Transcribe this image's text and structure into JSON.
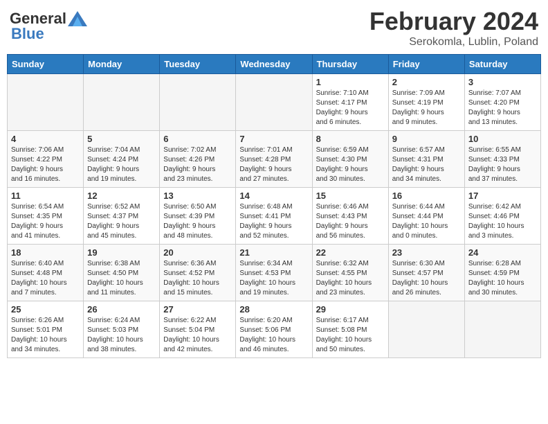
{
  "header": {
    "logo_general": "General",
    "logo_blue": "Blue",
    "title": "February 2024",
    "location": "Serokomla, Lublin, Poland"
  },
  "days_of_week": [
    "Sunday",
    "Monday",
    "Tuesday",
    "Wednesday",
    "Thursday",
    "Friday",
    "Saturday"
  ],
  "weeks": [
    [
      {
        "day": "",
        "info": ""
      },
      {
        "day": "",
        "info": ""
      },
      {
        "day": "",
        "info": ""
      },
      {
        "day": "",
        "info": ""
      },
      {
        "day": "1",
        "info": "Sunrise: 7:10 AM\nSunset: 4:17 PM\nDaylight: 9 hours\nand 6 minutes."
      },
      {
        "day": "2",
        "info": "Sunrise: 7:09 AM\nSunset: 4:19 PM\nDaylight: 9 hours\nand 9 minutes."
      },
      {
        "day": "3",
        "info": "Sunrise: 7:07 AM\nSunset: 4:20 PM\nDaylight: 9 hours\nand 13 minutes."
      }
    ],
    [
      {
        "day": "4",
        "info": "Sunrise: 7:06 AM\nSunset: 4:22 PM\nDaylight: 9 hours\nand 16 minutes."
      },
      {
        "day": "5",
        "info": "Sunrise: 7:04 AM\nSunset: 4:24 PM\nDaylight: 9 hours\nand 19 minutes."
      },
      {
        "day": "6",
        "info": "Sunrise: 7:02 AM\nSunset: 4:26 PM\nDaylight: 9 hours\nand 23 minutes."
      },
      {
        "day": "7",
        "info": "Sunrise: 7:01 AM\nSunset: 4:28 PM\nDaylight: 9 hours\nand 27 minutes."
      },
      {
        "day": "8",
        "info": "Sunrise: 6:59 AM\nSunset: 4:30 PM\nDaylight: 9 hours\nand 30 minutes."
      },
      {
        "day": "9",
        "info": "Sunrise: 6:57 AM\nSunset: 4:31 PM\nDaylight: 9 hours\nand 34 minutes."
      },
      {
        "day": "10",
        "info": "Sunrise: 6:55 AM\nSunset: 4:33 PM\nDaylight: 9 hours\nand 37 minutes."
      }
    ],
    [
      {
        "day": "11",
        "info": "Sunrise: 6:54 AM\nSunset: 4:35 PM\nDaylight: 9 hours\nand 41 minutes."
      },
      {
        "day": "12",
        "info": "Sunrise: 6:52 AM\nSunset: 4:37 PM\nDaylight: 9 hours\nand 45 minutes."
      },
      {
        "day": "13",
        "info": "Sunrise: 6:50 AM\nSunset: 4:39 PM\nDaylight: 9 hours\nand 48 minutes."
      },
      {
        "day": "14",
        "info": "Sunrise: 6:48 AM\nSunset: 4:41 PM\nDaylight: 9 hours\nand 52 minutes."
      },
      {
        "day": "15",
        "info": "Sunrise: 6:46 AM\nSunset: 4:43 PM\nDaylight: 9 hours\nand 56 minutes."
      },
      {
        "day": "16",
        "info": "Sunrise: 6:44 AM\nSunset: 4:44 PM\nDaylight: 10 hours\nand 0 minutes."
      },
      {
        "day": "17",
        "info": "Sunrise: 6:42 AM\nSunset: 4:46 PM\nDaylight: 10 hours\nand 3 minutes."
      }
    ],
    [
      {
        "day": "18",
        "info": "Sunrise: 6:40 AM\nSunset: 4:48 PM\nDaylight: 10 hours\nand 7 minutes."
      },
      {
        "day": "19",
        "info": "Sunrise: 6:38 AM\nSunset: 4:50 PM\nDaylight: 10 hours\nand 11 minutes."
      },
      {
        "day": "20",
        "info": "Sunrise: 6:36 AM\nSunset: 4:52 PM\nDaylight: 10 hours\nand 15 minutes."
      },
      {
        "day": "21",
        "info": "Sunrise: 6:34 AM\nSunset: 4:53 PM\nDaylight: 10 hours\nand 19 minutes."
      },
      {
        "day": "22",
        "info": "Sunrise: 6:32 AM\nSunset: 4:55 PM\nDaylight: 10 hours\nand 23 minutes."
      },
      {
        "day": "23",
        "info": "Sunrise: 6:30 AM\nSunset: 4:57 PM\nDaylight: 10 hours\nand 26 minutes."
      },
      {
        "day": "24",
        "info": "Sunrise: 6:28 AM\nSunset: 4:59 PM\nDaylight: 10 hours\nand 30 minutes."
      }
    ],
    [
      {
        "day": "25",
        "info": "Sunrise: 6:26 AM\nSunset: 5:01 PM\nDaylight: 10 hours\nand 34 minutes."
      },
      {
        "day": "26",
        "info": "Sunrise: 6:24 AM\nSunset: 5:03 PM\nDaylight: 10 hours\nand 38 minutes."
      },
      {
        "day": "27",
        "info": "Sunrise: 6:22 AM\nSunset: 5:04 PM\nDaylight: 10 hours\nand 42 minutes."
      },
      {
        "day": "28",
        "info": "Sunrise: 6:20 AM\nSunset: 5:06 PM\nDaylight: 10 hours\nand 46 minutes."
      },
      {
        "day": "29",
        "info": "Sunrise: 6:17 AM\nSunset: 5:08 PM\nDaylight: 10 hours\nand 50 minutes."
      },
      {
        "day": "",
        "info": ""
      },
      {
        "day": "",
        "info": ""
      }
    ]
  ]
}
